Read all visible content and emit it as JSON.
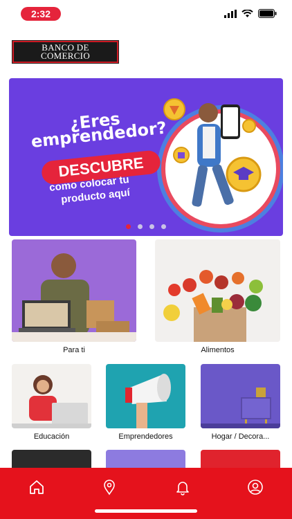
{
  "status": {
    "time": "2:32"
  },
  "logo": {
    "line1": "BANCO DE",
    "line2": "COMERCIO"
  },
  "banner": {
    "headline_1": "¿Eres",
    "headline_2": "emprendedor?",
    "cta": "DESCUBRE",
    "sub_1": "como colocar tu",
    "sub_2": "producto aquí",
    "dots_total": 4,
    "active_dot": 1
  },
  "categories_top": [
    {
      "label": "Para ti"
    },
    {
      "label": "Alimentos"
    }
  ],
  "categories_mid": [
    {
      "label": "Educación"
    },
    {
      "label": "Emprendedores"
    },
    {
      "label": "Hogar / Decora..."
    }
  ],
  "nav": {
    "items": [
      "home-icon",
      "location-pin-icon",
      "bell-icon",
      "user-icon"
    ]
  },
  "colors": {
    "brand_red": "#e5121c",
    "banner_purple": "#6a3ee0",
    "pill_red": "#e5243b"
  }
}
